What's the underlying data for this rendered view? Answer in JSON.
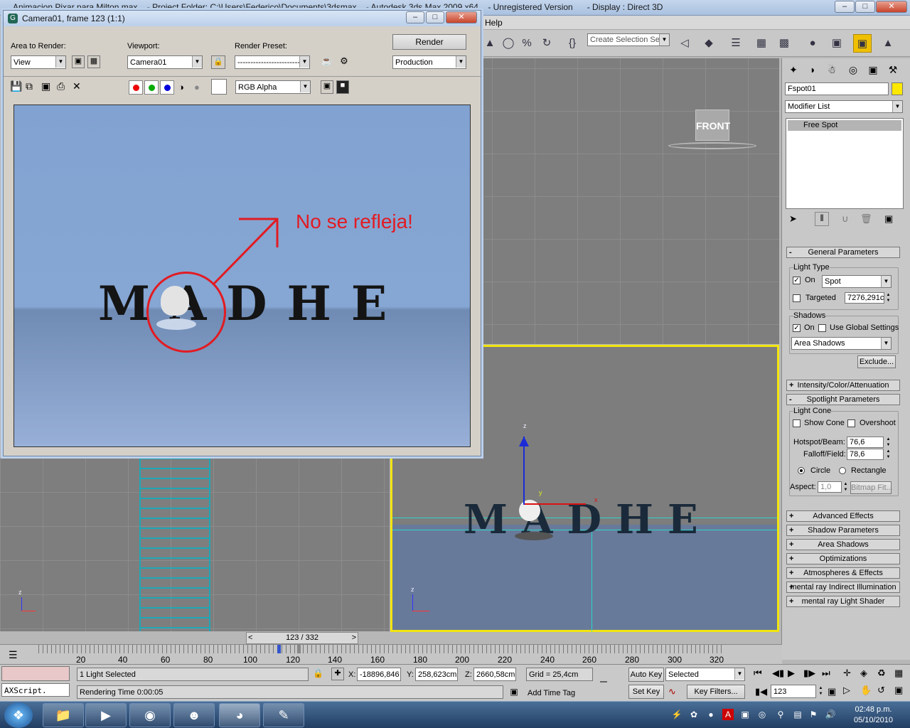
{
  "app": {
    "title_left": "Animacion Pixar para Milton.max",
    "title_project": "- Project Folder: C:\\Users\\Federico\\Documents\\3dsmax",
    "title_app": "- Autodesk 3ds Max 2009 x64",
    "title_reg": "- Unregistered Version",
    "title_display": "- Display : Direct 3D",
    "menu_help": "Help"
  },
  "toolbar": {
    "selection_set_placeholder": "Create Selection Set"
  },
  "render_window": {
    "title": "Camera01, frame 123 (1:1)",
    "area_label": "Area to Render:",
    "area_value": "View",
    "viewport_label": "Viewport:",
    "viewport_value": "Camera01",
    "preset_label": "Render Preset:",
    "preset_value": "-------------------------",
    "render_button": "Render",
    "production_value": "Production",
    "channel_value": "RGB Alpha",
    "annotation_text": "No se refleja!",
    "letters": [
      "M",
      "A",
      "D",
      "H",
      "E"
    ]
  },
  "viewports": {
    "front_label": "FRONT",
    "axis_z": "z",
    "axis_x": "x",
    "axis_y": "y"
  },
  "command_panel": {
    "object_name": "Fspot01",
    "object_color": "#ffe800",
    "modifier_list": "Modifier List",
    "stack_item": "Free Spot",
    "rollouts": {
      "general": "General Parameters",
      "intensity": "Intensity/Color/Attenuation",
      "spotlight": "Spotlight Parameters",
      "advanced": "Advanced Effects",
      "shadow_params": "Shadow Parameters",
      "area_shadows": "Area Shadows",
      "optimizations": "Optimizations",
      "atmospheres": "Atmospheres & Effects",
      "mr_indirect": "mental ray Indirect Illumination",
      "mr_shader": "mental ray Light Shader"
    },
    "light_type_label": "Light Type",
    "on_label": "On",
    "light_type_value": "Spot",
    "targeted_label": "Targeted",
    "targeted_value": "7276,291c",
    "shadows_label": "Shadows",
    "shadows_on_label": "On",
    "use_global_label": "Use Global Settings",
    "shadow_type_value": "Area Shadows",
    "exclude_button": "Exclude...",
    "light_cone_label": "Light Cone",
    "show_cone_label": "Show Cone",
    "overshoot_label": "Overshoot",
    "hotspot_label": "Hotspot/Beam:",
    "hotspot_value": "76,6",
    "falloff_label": "Falloff/Field:",
    "falloff_value": "78,6",
    "circle_label": "Circle",
    "rectangle_label": "Rectangle",
    "aspect_label": "Aspect:",
    "aspect_value": "1,0",
    "bitmap_fit_button": "Bitmap Fit..."
  },
  "timeline": {
    "slider_text": "123 / 332",
    "ticks": [
      "20",
      "40",
      "60",
      "80",
      "100",
      "120",
      "140",
      "160",
      "180",
      "200",
      "220",
      "240",
      "260",
      "280",
      "300",
      "320"
    ]
  },
  "status": {
    "maxscript": "AXScript.",
    "selected_text": "1 Light Selected",
    "rendering_time": "Rendering Time  0:00:05",
    "x_label": "X:",
    "x_value": "-18896,846",
    "y_label": "Y:",
    "y_value": "258,623cm",
    "z_label": "Z:",
    "z_value": "2660,58cm",
    "grid_text": "Grid = 25,4cm",
    "add_time_tag": "Add Time Tag",
    "auto_key": "Auto Key",
    "set_key": "Set Key",
    "selected_dropdown": "Selected",
    "key_filters": "Key Filters...",
    "frame_value": "123"
  },
  "taskbar": {
    "time": "02:48 p.m.",
    "date": "05/10/2010"
  }
}
